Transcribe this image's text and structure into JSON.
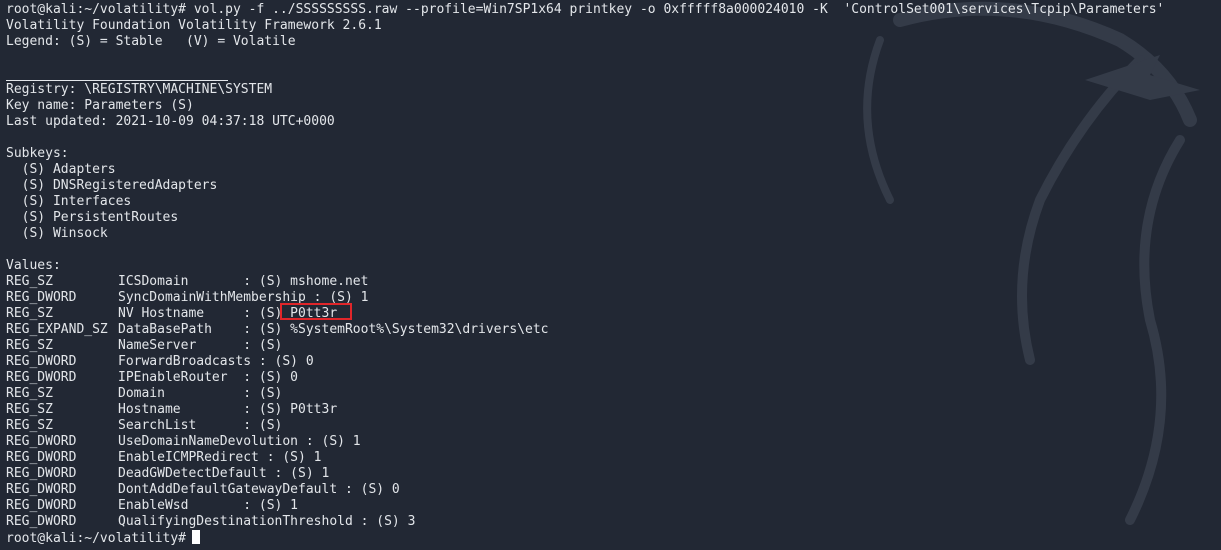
{
  "command_line": {
    "prompt": "root@kali:~/volatility#",
    "command": "vol.py -f ../SSSSSSSSS.raw --profile=Win7SP1x64 printkey -o 0xfffff8a000024010 -K  'ControlSet001\\services\\Tcpip\\Parameters'"
  },
  "header": {
    "banner": "Volatility Foundation Volatility Framework 2.6.1",
    "legend": "Legend: (S) = Stable   (V) = Volatile"
  },
  "registry": {
    "registry_line": "Registry: \\REGISTRY\\MACHINE\\SYSTEM",
    "key_name_line": "Key name: Parameters (S)",
    "last_updated_line": "Last updated: 2021-10-09 04:37:18 UTC+0000"
  },
  "subkeys": {
    "heading": "Subkeys:",
    "items": [
      "  (S) Adapters",
      "  (S) DNSRegisteredAdapters",
      "  (S) Interfaces",
      "  (S) PersistentRoutes",
      "  (S) Winsock"
    ]
  },
  "values": {
    "heading": "Values:",
    "rows": [
      {
        "type": "REG_SZ",
        "entry": "ICSDomain       : (S) mshome.net"
      },
      {
        "type": "REG_DWORD",
        "entry": "SyncDomainWithMembership : (S) 1"
      },
      {
        "type": "REG_SZ",
        "entry": "NV Hostname     : (S) P0tt3r"
      },
      {
        "type": "REG_EXPAND_SZ",
        "entry": "DataBasePath    : (S) %SystemRoot%\\System32\\drivers\\etc"
      },
      {
        "type": "REG_SZ",
        "entry": "NameServer      : (S)"
      },
      {
        "type": "REG_DWORD",
        "entry": "ForwardBroadcasts : (S) 0"
      },
      {
        "type": "REG_DWORD",
        "entry": "IPEnableRouter  : (S) 0"
      },
      {
        "type": "REG_SZ",
        "entry": "Domain          : (S)"
      },
      {
        "type": "REG_SZ",
        "entry": "Hostname        : (S) P0tt3r"
      },
      {
        "type": "REG_SZ",
        "entry": "SearchList      : (S)"
      },
      {
        "type": "REG_DWORD",
        "entry": "UseDomainNameDevolution : (S) 1"
      },
      {
        "type": "REG_DWORD",
        "entry": "EnableICMPRedirect : (S) 1"
      },
      {
        "type": "REG_DWORD",
        "entry": "DeadGWDetectDefault : (S) 1"
      },
      {
        "type": "REG_DWORD",
        "entry": "DontAddDefaultGatewayDefault : (S) 0"
      },
      {
        "type": "REG_DWORD",
        "entry": "EnableWsd       : (S) 1"
      },
      {
        "type": "REG_DWORD",
        "entry": "QualifyingDestinationThreshold : (S) 3"
      }
    ]
  },
  "final_prompt": "root@kali:~/volatility#",
  "colors": {
    "background": "#222834",
    "text": "#e3e6ea",
    "highlight_box": "#e0262a"
  },
  "icons": {
    "background_logo": "kali-dragon-icon"
  }
}
